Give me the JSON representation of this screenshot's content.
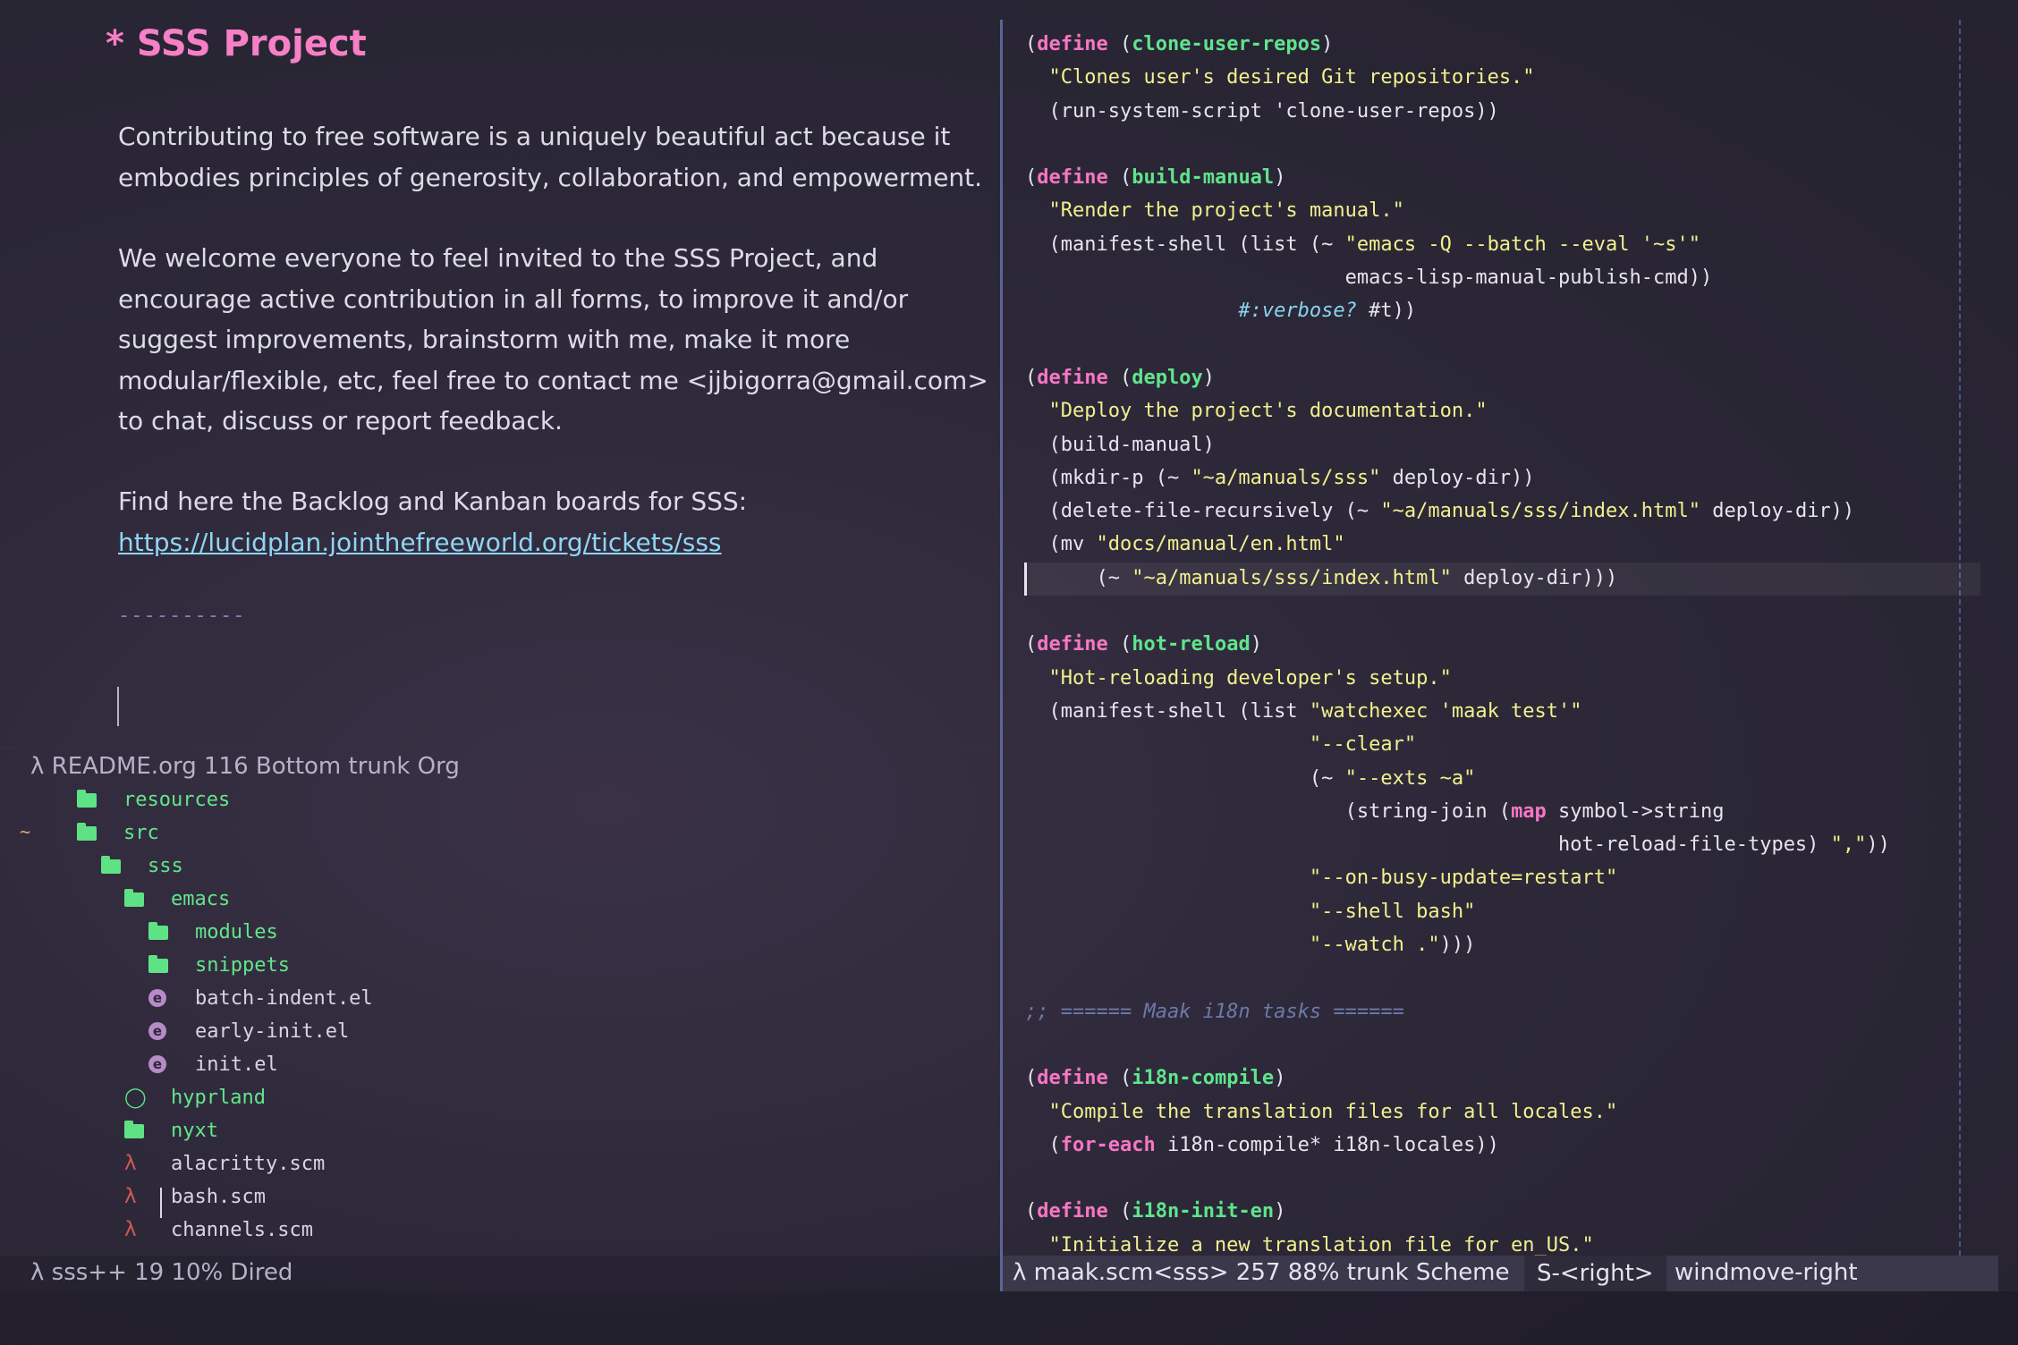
{
  "org": {
    "heading": "* SSS Project",
    "para1": [
      "Contributing to free software is a uniquely beautiful act because it",
      "embodies principles of generosity, collaboration, and empowerment."
    ],
    "para2": [
      "We welcome everyone to feel invited to the SSS Project, and",
      "encourage active contribution in all forms, to improve it and/or",
      "suggest improvements, brainstorm with me, make it more",
      "modular/flexible, etc, feel free to contact me <jjbigorra@gmail.com>",
      "to chat, discuss or report feedback."
    ],
    "para3_line1": "Find here the Backlog and Kanban boards for SSS:",
    "link": "https://lucidplan.jointhefreeworld.org/tickets/sss",
    "rule": "----------"
  },
  "modeline_left_top": "λ README.org 116 Bottom trunk Org",
  "modeline_left_bottom": "λ sss++ 19 10% Dired",
  "dired": {
    "tilde_marker": "~",
    "rows": [
      {
        "name": "resources",
        "kind": "dir"
      },
      {
        "name": "src",
        "kind": "dir"
      },
      {
        "name": "sss",
        "kind": "dir"
      },
      {
        "name": "emacs",
        "kind": "dir"
      },
      {
        "name": "modules",
        "kind": "dir"
      },
      {
        "name": "snippets",
        "kind": "dir"
      },
      {
        "name": "batch-indent.el",
        "kind": "emacs-lisp"
      },
      {
        "name": "early-init.el",
        "kind": "emacs-lisp"
      },
      {
        "name": "init.el",
        "kind": "emacs-lisp"
      },
      {
        "name": "hyprland",
        "kind": "hyprland-dir"
      },
      {
        "name": "nyxt",
        "kind": "dir"
      },
      {
        "name": "alacritty.scm",
        "kind": "scheme"
      },
      {
        "name": "bash.scm",
        "kind": "scheme"
      },
      {
        "name": "channels.scm",
        "kind": "scheme"
      }
    ]
  },
  "modeline_right": {
    "status": "λ maak.scm<sss> 257 88% trunk Scheme",
    "key": "S-<right>",
    "command": "windmove-right"
  },
  "icons": {
    "folder": "folder-icon",
    "emacs": "emacs-file-icon",
    "scheme": "lambda-icon",
    "hyprland": "hyprland-drop-icon"
  }
}
